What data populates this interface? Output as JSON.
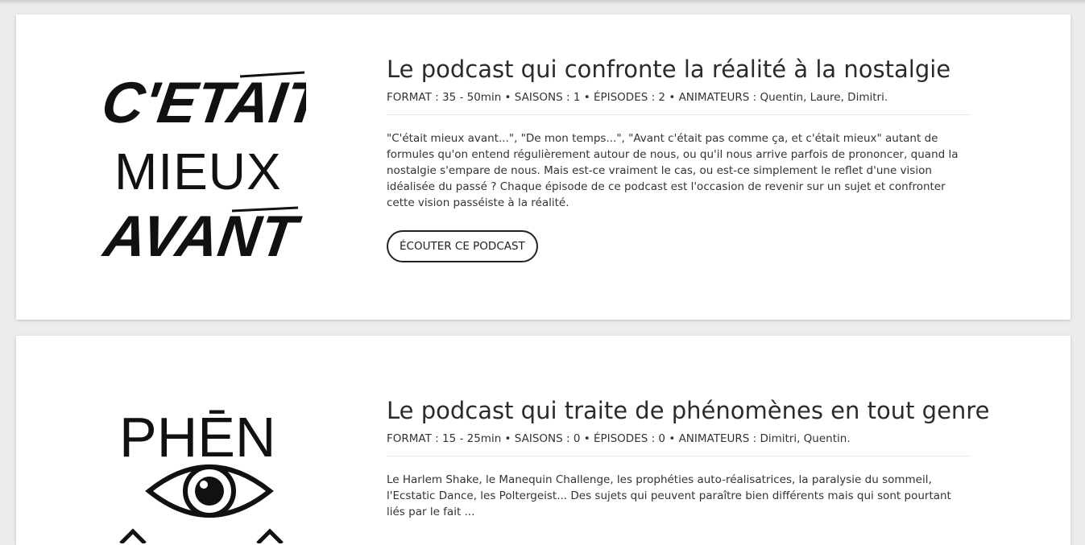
{
  "podcasts": [
    {
      "logo_text": [
        "C'ETAIT",
        "MIEUX",
        "AVANT"
      ],
      "title": "Le podcast qui confronte la réalité à la nostalgie",
      "meta": "FORMAT : 35 - 50min • SAISONS : 1 • ÉPISODES : 2 • ANIMATEURS : Quentin, Laure, Dimitri.",
      "description": "\"C'était mieux avant...\", \"De mon temps...\", \"Avant c'était pas comme ça, et c'était mieux\" autant de formules qu'on entend régulièrement autour de nous, ou qu'il nous arrive parfois de prononcer, quand la nostalgie s'empare de nous. Mais est-ce vraiment le cas, ou est-ce simplement le reflet d'une vision idéalisée du passé ? Chaque épisode de ce podcast est l'occasion de revenir sur un sujet et confronter cette vision passéiste à la réalité.",
      "button_label": "ÉCOUTER CE PODCAST"
    },
    {
      "logo_text": [
        "PHĒN"
      ],
      "title": "Le podcast qui traite de phénomènes en tout genre",
      "meta": "FORMAT : 15 - 25min • SAISONS : 0 • ÉPISODES : 0 • ANIMATEURS : Dimitri, Quentin.",
      "description": "Le Harlem Shake, le Manequin Challenge, les prophéties auto-réalisatrices, la paralysie du sommeil, l'Ecstatic Dance, les Poltergeist... Des sujets qui peuvent paraître bien différents mais qui sont pourtant liés par le fait ..."
    }
  ],
  "colors": {
    "background": "#ececec",
    "card": "#ffffff",
    "text": "#2a2a2a",
    "logo": "#111111"
  }
}
